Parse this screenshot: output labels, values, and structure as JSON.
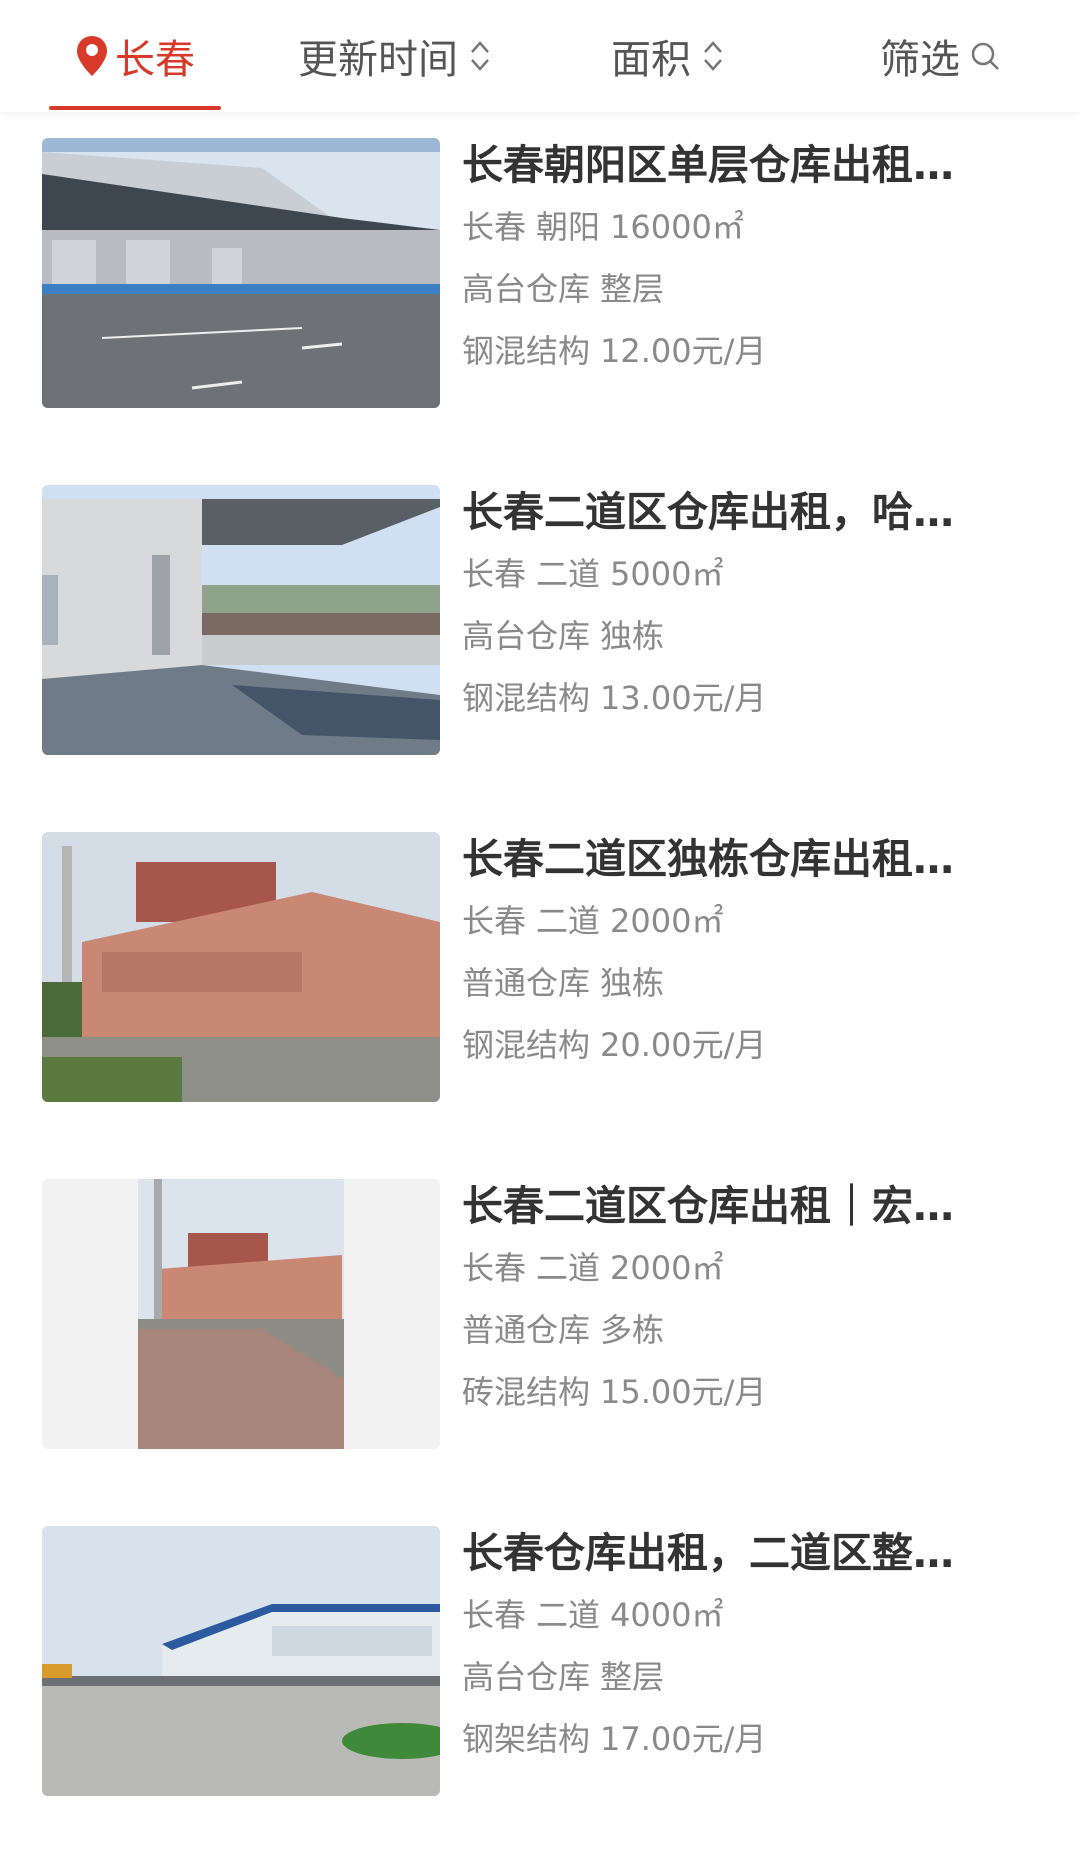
{
  "header": {
    "city": "长春",
    "sort_time": "更新时间",
    "sort_area": "面积",
    "filter": "筛选",
    "accent": "#d83a2a"
  },
  "listings": [
    {
      "title": "长春朝阳区单层仓库出租…",
      "city": "长春",
      "district": "朝阳",
      "area": "16000㎡",
      "type": "高台仓库",
      "layout": "整层",
      "structure": "钢混结构",
      "price": "12.00元/月"
    },
    {
      "title": "长春二道区仓库出租，哈…",
      "city": "长春",
      "district": "二道",
      "area": "5000㎡",
      "type": "高台仓库",
      "layout": "独栋",
      "structure": "钢混结构",
      "price": "13.00元/月"
    },
    {
      "title": "长春二道区独栋仓库出租…",
      "city": "长春",
      "district": "二道",
      "area": "2000㎡",
      "type": "普通仓库",
      "layout": "独栋",
      "structure": "钢混结构",
      "price": "20.00元/月"
    },
    {
      "title": "长春二道区仓库出租｜宏…",
      "city": "长春",
      "district": "二道",
      "area": "2000㎡",
      "type": "普通仓库",
      "layout": "多栋",
      "structure": "砖混结构",
      "price": "15.00元/月"
    },
    {
      "title": "长春仓库出租，二道区整…",
      "city": "长春",
      "district": "二道",
      "area": "4000㎡",
      "type": "高台仓库",
      "layout": "整层",
      "structure": "钢架结构",
      "price": "17.00元/月"
    }
  ]
}
